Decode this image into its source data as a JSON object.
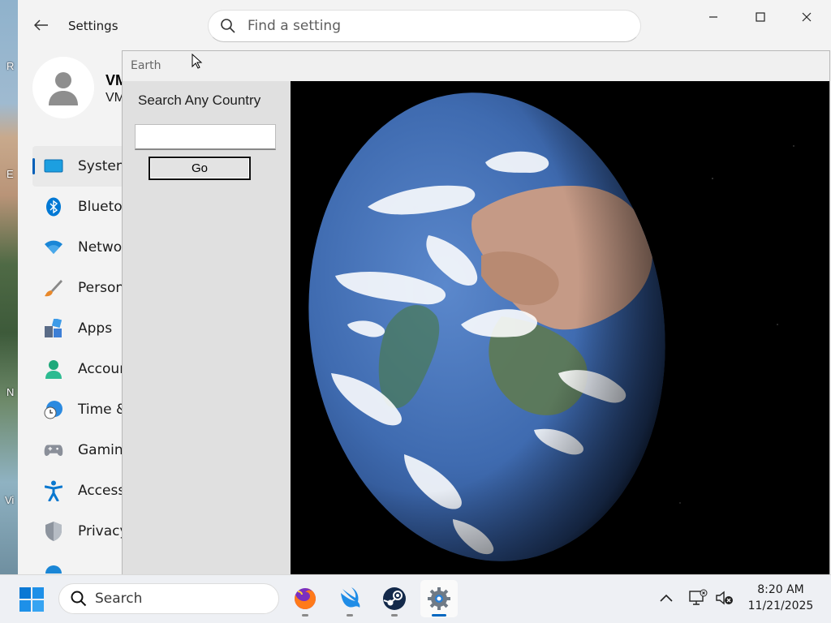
{
  "desktop": {
    "edge_letters": [
      "R",
      "E",
      "N",
      "Vi"
    ]
  },
  "settings": {
    "title": "Settings",
    "search_placeholder": "Find a setting",
    "user": {
      "name": "VM",
      "subtitle": "VM"
    },
    "nav": [
      {
        "label": "System",
        "icon": "monitor-icon",
        "active": true
      },
      {
        "label": "Bluetoo",
        "icon": "bluetooth-icon"
      },
      {
        "label": "Networ",
        "icon": "wifi-icon"
      },
      {
        "label": "Persona",
        "icon": "paintbrush-icon"
      },
      {
        "label": "Apps",
        "icon": "apps-icon"
      },
      {
        "label": "Accoun",
        "icon": "account-icon"
      },
      {
        "label": "Time &",
        "icon": "clock-globe-icon"
      },
      {
        "label": "Gaming",
        "icon": "gamepad-icon"
      },
      {
        "label": "Accessi",
        "icon": "accessibility-icon"
      },
      {
        "label": "Privacy",
        "icon": "shield-icon"
      }
    ]
  },
  "earth_app": {
    "title": "Earth",
    "panel_heading": "Search Any Country",
    "country_input_value": "",
    "go_label": "Go"
  },
  "taskbar": {
    "search_label": "Search",
    "apps": [
      {
        "name": "firefox-icon",
        "active": false
      },
      {
        "name": "swift-bird-icon",
        "active": false
      },
      {
        "name": "steam-icon",
        "active": false
      },
      {
        "name": "settings-gear-icon",
        "active": true
      }
    ],
    "time": "8:20 AM",
    "date": "11/21/2025"
  },
  "colors": {
    "accent": "#005fb8",
    "taskbar_accent": "#0067c0",
    "space": "#000000",
    "ocean": "#3f6bb0"
  }
}
